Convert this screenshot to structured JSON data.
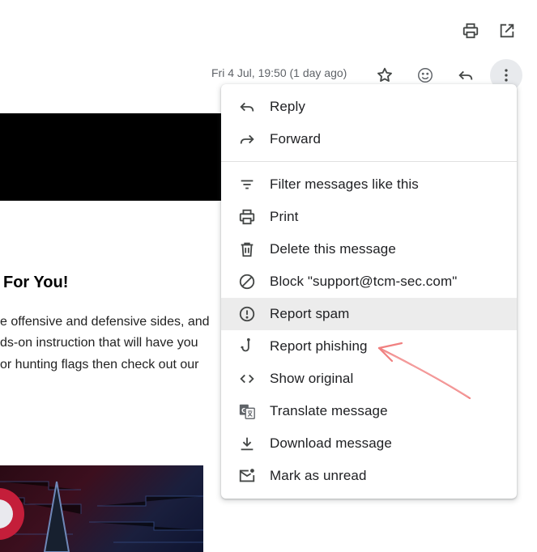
{
  "toolbar": {
    "print_icon": "print-icon",
    "open_new_window_icon": "open-in-new-icon"
  },
  "message_header": {
    "date": "Fri 4 Jul, 19:50 (1 day ago)",
    "icons": [
      "star-icon",
      "emoji-icon",
      "reply-icon",
      "more-vert-icon"
    ]
  },
  "email": {
    "heading": "For You!",
    "lines": [
      "e offensive and defensive sides, and",
      "ds-on instruction that will have you",
      "or hunting flags then check out our"
    ]
  },
  "menu": {
    "items": [
      {
        "label": "Reply",
        "icon": "reply-icon"
      },
      {
        "label": "Forward",
        "icon": "forward-icon"
      },
      {
        "label": "Filter messages like this",
        "icon": "filter-icon"
      },
      {
        "label": "Print",
        "icon": "print-icon"
      },
      {
        "label": "Delete this message",
        "icon": "delete-icon"
      },
      {
        "label": "Block \"support@tcm-sec.com\"",
        "icon": "block-icon"
      },
      {
        "label": "Report spam",
        "icon": "report-spam-icon"
      },
      {
        "label": "Report phishing",
        "icon": "phishing-hook-icon"
      },
      {
        "label": "Show original",
        "icon": "code-icon"
      },
      {
        "label": "Translate message",
        "icon": "translate-icon"
      },
      {
        "label": "Download message",
        "icon": "download-icon"
      },
      {
        "label": "Mark as unread",
        "icon": "mark-unread-icon"
      }
    ],
    "highlighted": "Report spam"
  },
  "colors": {
    "icon": "#444746",
    "annotation_arrow": "#f08080",
    "highlight": "#ececec"
  }
}
